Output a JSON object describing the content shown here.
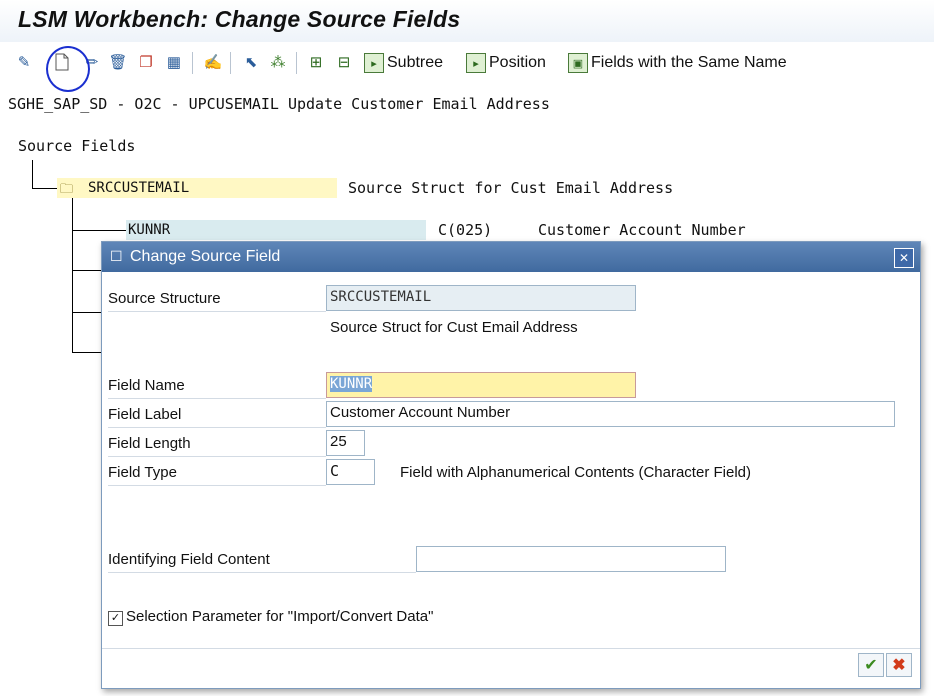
{
  "window": {
    "title": "LSM Workbench: Change Source Fields"
  },
  "toolbar": {
    "icons": [
      "display-change-icon",
      "create-icon",
      "change-icon",
      "delete-icon",
      "copy-icon",
      "table-icon",
      "edit-icon",
      "select-icon",
      "hierarchy-icon",
      "expand-icon",
      "collapse-icon"
    ],
    "subtree_label": "Subtree",
    "position_label": "Position",
    "same_name_label": "Fields with the Same Name"
  },
  "project_line": "SGHE_SAP_SD - O2C - UPCUSEMAIL Update Customer Email Address",
  "tree": {
    "root_label": "Source Fields",
    "structure": {
      "name": "SRCCUSTEMAIL",
      "description": "Source Struct for Cust Email Address"
    },
    "field": {
      "name": "KUNNR",
      "length": "C(025)",
      "description": "Customer Account Number"
    }
  },
  "dialog": {
    "title": "Change Source Field",
    "source_structure_label": "Source Structure",
    "source_structure_value": "SRCCUSTEMAIL",
    "source_structure_desc": "Source Struct for Cust Email Address",
    "field_name_label": "Field Name",
    "field_name_value": "KUNNR",
    "field_label_label": "Field Label",
    "field_label_value": "Customer Account Number",
    "field_length_label": "Field Length",
    "field_length_value": "25",
    "field_type_label": "Field Type",
    "field_type_value": "C",
    "field_type_desc": "Field with Alphanumerical Contents (Character Field)",
    "identifying_label": "Identifying Field Content",
    "identifying_value": "",
    "selection_param_label": "Selection Parameter for \"Import/Convert Data\"",
    "selection_param_checked": "✓"
  },
  "colors": {
    "dialog_header": "#4f78ad",
    "focus_field": "#fff3a8",
    "structure_highlight": "#fff8c4"
  }
}
